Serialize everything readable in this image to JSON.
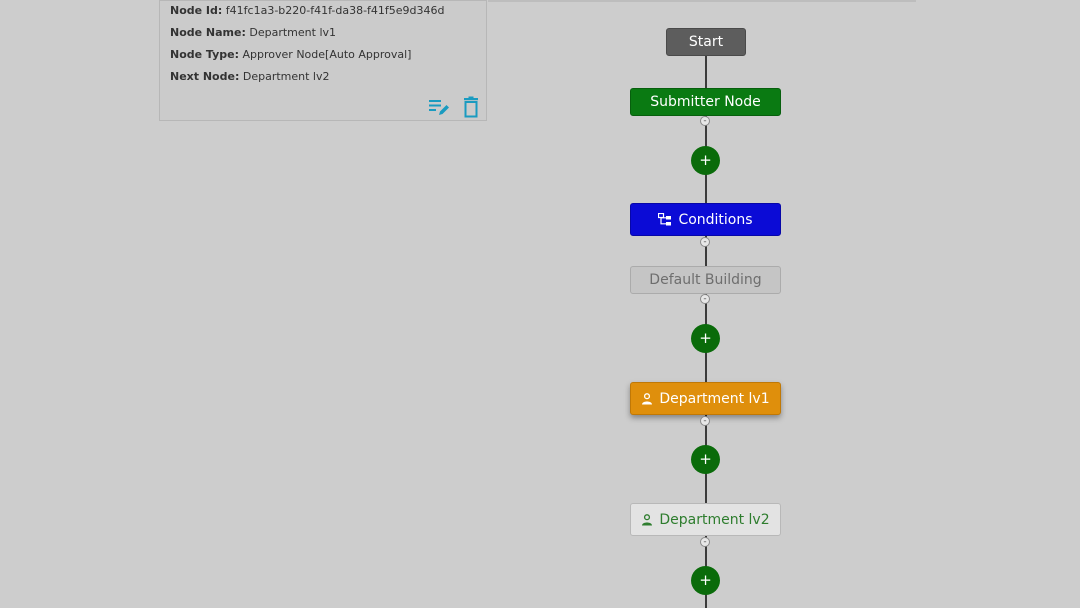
{
  "details": {
    "node_id_label": "Node Id:",
    "node_id": "f41fc1a3-b220-f41f-da38-f41f5e9d346d",
    "node_name_label": "Node Name:",
    "node_name": "Department lv1",
    "node_type_label": "Node Type:",
    "node_type": "Approver Node[Auto Approval]",
    "next_node_label": "Next Node:",
    "next_node": "Department lv2",
    "actions": {
      "edit_icon": "edit-list-icon",
      "delete_icon": "trash-icon"
    },
    "icon_color": "#1a9bc0"
  },
  "flow": {
    "start": {
      "label": "Start"
    },
    "submitter": {
      "label": "Submitter Node",
      "color": "#0a7a12"
    },
    "conditions": {
      "label": "Conditions",
      "icon": "branch-tree-icon",
      "color": "#0b0bd6"
    },
    "default_building": {
      "label": "Default Building"
    },
    "department_lv1": {
      "label": "Department lv1",
      "icon": "person-icon",
      "color": "#df8f0c"
    },
    "department_lv2": {
      "label": "Department lv2",
      "icon": "person-icon"
    },
    "collapse_symbol": "-",
    "add_symbol": "+"
  }
}
